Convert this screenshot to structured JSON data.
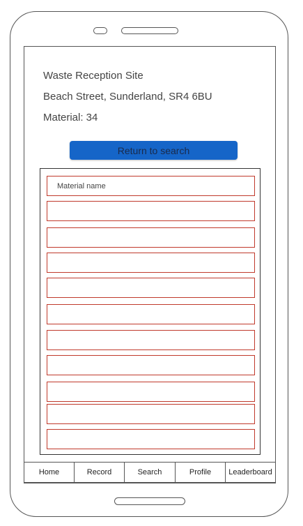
{
  "site": {
    "name": "Waste Reception Site",
    "address": "Beach Street, Sunderland, SR4 6BU",
    "material": "Material: 34"
  },
  "actions": {
    "return_label": "Return to search"
  },
  "materials": {
    "rows": [
      "Material name",
      "",
      "",
      "",
      "",
      "",
      "",
      "",
      "",
      "",
      ""
    ]
  },
  "tabs": [
    "Home",
    "Record",
    "Search",
    "Profile",
    "Leaderboard"
  ],
  "colors": {
    "accent": "#1565c8",
    "row_border": "#c0392b"
  }
}
